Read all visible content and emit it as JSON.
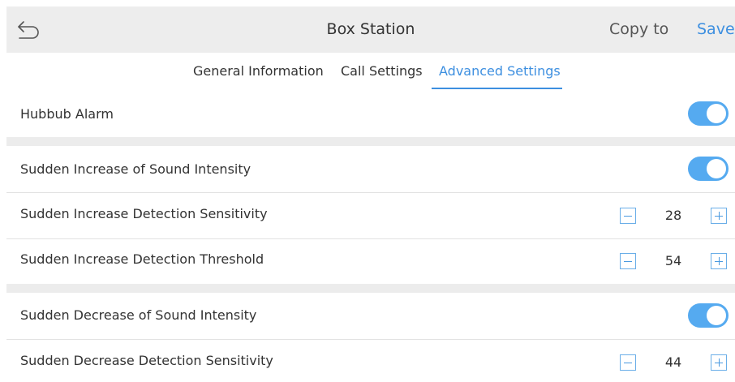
{
  "header": {
    "back_icon": "back-arrow-icon",
    "title": "Box Station",
    "copy_label": "Copy to",
    "save_label": "Save"
  },
  "tabs": [
    {
      "label": "General Information",
      "active": false
    },
    {
      "label": "Call Settings",
      "active": false
    },
    {
      "label": "Advanced Settings",
      "active": true
    }
  ],
  "settings": {
    "hubbub_alarm": {
      "label": "Hubbub Alarm",
      "enabled": true
    },
    "sudden_increase": {
      "label": "Sudden Increase of Sound Intensity",
      "enabled": true
    },
    "increase_sensitivity": {
      "label": "Sudden Increase Detection Sensitivity",
      "value": "28"
    },
    "increase_threshold": {
      "label": "Sudden Increase Detection Threshold",
      "value": "54"
    },
    "sudden_decrease": {
      "label": "Sudden Decrease of Sound Intensity",
      "enabled": true
    },
    "decrease_sensitivity": {
      "label": "Sudden Decrease Detection Sensitivity",
      "value": "44"
    }
  },
  "colors": {
    "accent": "#3d8fe0",
    "toggle_on": "#55aaf0",
    "header_bg": "#ededed",
    "section_band": "#ececec"
  }
}
